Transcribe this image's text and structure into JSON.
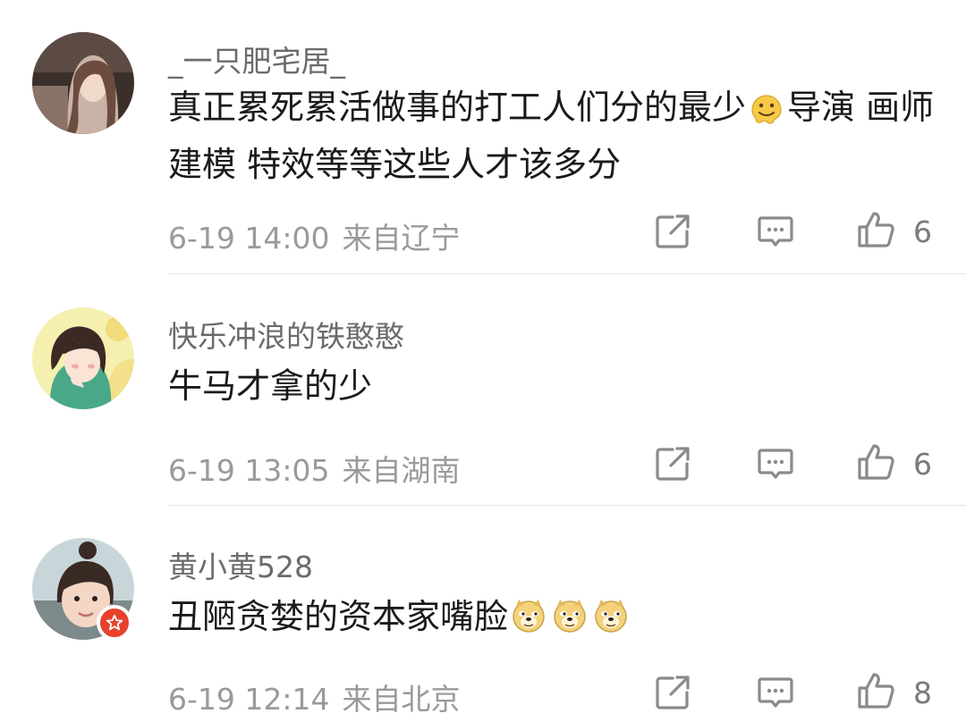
{
  "comments": [
    {
      "username": "_一只肥宅居_",
      "text_part1": "真正累死累活做事的打工人们分的最少",
      "emoji": "melting-face",
      "text_part2": "导演 画师 建模 特效等等这些人才该多分",
      "time": "6-19 14:00",
      "location": "来自辽宁",
      "likes": "6"
    },
    {
      "username": "快乐冲浪的铁憨憨",
      "text": "牛马才拿的少",
      "time": "6-19 13:05",
      "location": "来自湖南",
      "likes": "6"
    },
    {
      "username": "黄小黄528",
      "text": "丑陋贪婪的资本家嘴脸",
      "emoji": "doge",
      "emoji_count": 3,
      "time": "6-19 12:14",
      "location": "来自北京",
      "likes": "8",
      "verified_badge": "star"
    }
  ],
  "icons": {
    "share": "share-icon",
    "reply": "comment-icon",
    "like": "thumbs-up-icon"
  },
  "colors": {
    "username": "#6b6b6b",
    "meta": "#9a9a9a",
    "icon": "#8a8a8a",
    "badge": "#e8412c"
  }
}
